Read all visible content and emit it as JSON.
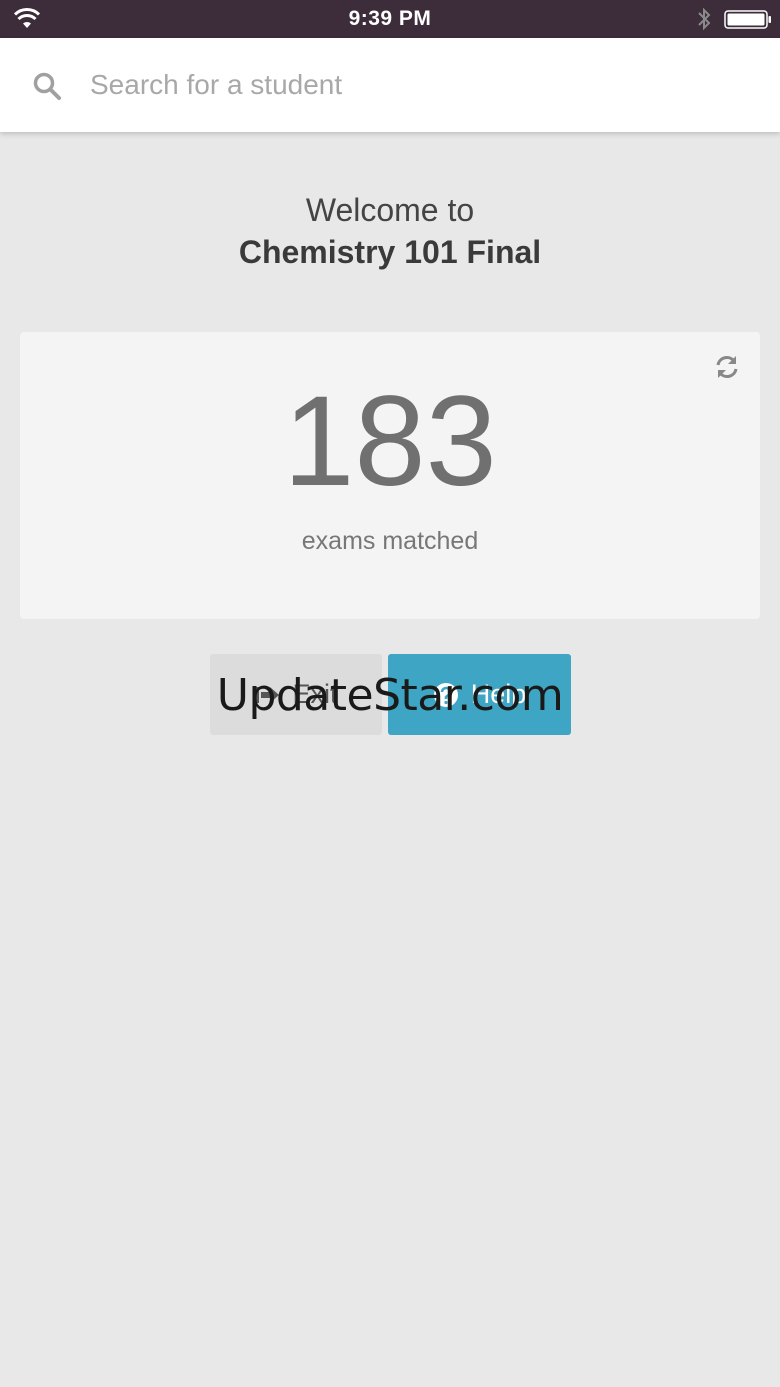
{
  "status_bar": {
    "time": "9:39 PM",
    "icons": [
      "wifi-icon",
      "bluetooth-icon",
      "battery-icon"
    ]
  },
  "search": {
    "placeholder": "Search for a student",
    "value": ""
  },
  "welcome": {
    "line1": "Welcome to",
    "exam_name": "Chemistry 101 Final"
  },
  "stats": {
    "count": "183",
    "label": "exams matched"
  },
  "buttons": {
    "exit_label": "Exit",
    "help_label": "Help"
  },
  "watermark": "UpdateStar.com",
  "colors": {
    "status_bar": "#3d2c3a",
    "background": "#e8e8e8",
    "card": "#f4f4f4",
    "help_button": "#3ea6c4",
    "exit_button": "#dcdcdc"
  }
}
